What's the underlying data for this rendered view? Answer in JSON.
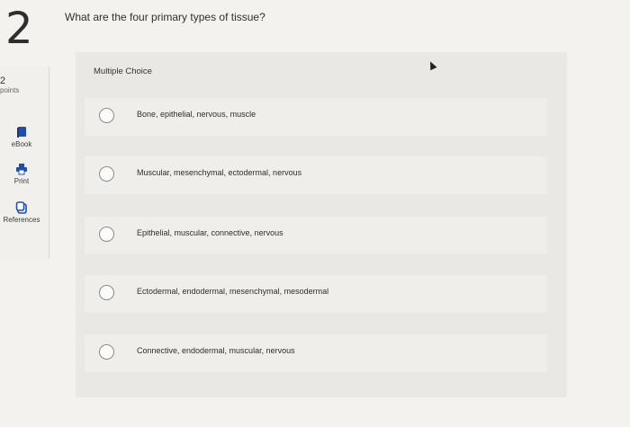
{
  "question": {
    "number": "2",
    "text": "What are the four primary types of tissue?"
  },
  "sidebar": {
    "points_value": "2",
    "points_label": "points",
    "tools": [
      {
        "label": "eBook",
        "icon": "book-icon"
      },
      {
        "label": "Print",
        "icon": "printer-icon"
      },
      {
        "label": "References",
        "icon": "references-icon"
      }
    ]
  },
  "answer": {
    "type_label": "Multiple Choice",
    "options": [
      "Bone, epithelial, nervous, muscle",
      "Muscular, mesenchymal, ectodermal, nervous",
      "Epithelial, muscular, connective, nervous",
      "Ectodermal, endodermal, mesenchymal, mesodermal",
      "Connective, endodermal, muscular, nervous"
    ]
  },
  "colors": {
    "accent": "#1f4fa8",
    "panel": "#e9e8e5",
    "option_bg": "#efeeeb"
  }
}
